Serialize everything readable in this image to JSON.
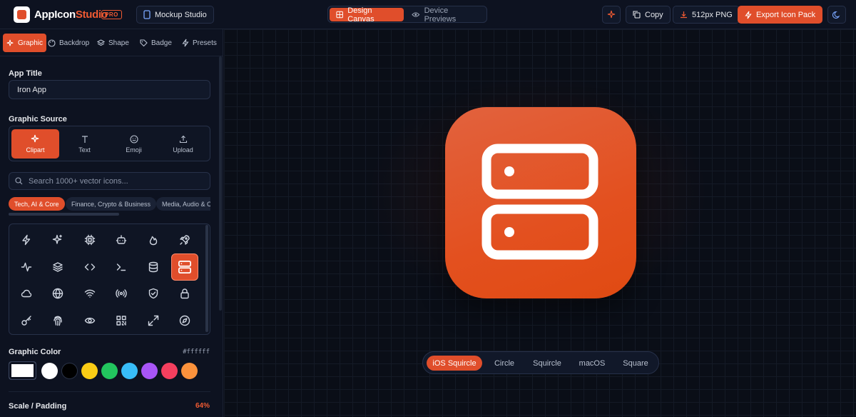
{
  "header": {
    "brand_prefix": "AppIcon",
    "brand_suffix": "Studio",
    "pro_badge": "PRO",
    "mockup_label": "Mockup Studio",
    "view_tabs": [
      {
        "label": "Design Canvas",
        "active": true
      },
      {
        "label": "Device Previews",
        "active": false
      }
    ],
    "copy_label": "Copy",
    "png_label": "512px PNG",
    "export_label": "Export Icon Pack"
  },
  "sidebar": {
    "tabs": [
      {
        "label": "Graphic",
        "active": true,
        "icon": "sparkles-icon"
      },
      {
        "label": "Backdrop",
        "active": false,
        "icon": "palette-icon"
      },
      {
        "label": "Shape",
        "active": false,
        "icon": "layers-icon"
      },
      {
        "label": "Badge",
        "active": false,
        "icon": "tag-icon"
      },
      {
        "label": "Presets",
        "active": false,
        "icon": "zap-icon"
      }
    ],
    "app_title_label": "App Title",
    "app_title_value": "Iron App",
    "graphic_source_label": "Graphic Source",
    "sources": [
      {
        "label": "Clipart",
        "active": true
      },
      {
        "label": "Text",
        "active": false
      },
      {
        "label": "Emoji",
        "active": false
      },
      {
        "label": "Upload",
        "active": false
      }
    ],
    "search_placeholder": "Search 1000+ vector icons...",
    "categories": [
      {
        "label": "Tech, AI & Core",
        "active": true
      },
      {
        "label": "Finance, Crypto & Business",
        "active": false
      },
      {
        "label": "Media, Audio & C…",
        "active": false
      }
    ],
    "icons": [
      "zap-icon",
      "sparkles-icon",
      "cpu-icon",
      "bot-icon",
      "flame-icon",
      "rocket-icon",
      "activity-icon",
      "layers-icon",
      "code-icon",
      "terminal-icon",
      "database-icon",
      "server-icon",
      "cloud-icon",
      "globe-icon",
      "wifi-icon",
      "radio-icon",
      "shield-icon",
      "lock-icon",
      "key-icon",
      "fingerprint-icon",
      "eye-icon",
      "qr-code-icon",
      "maximize-icon",
      "compass-icon"
    ],
    "selected_icon": "server-icon",
    "graphic_color_label": "Graphic Color",
    "graphic_color_value": "#ffffff",
    "swatches": [
      "#ffffff",
      "#000000",
      "#facc15",
      "#22c55e",
      "#38bdf8",
      "#a855f7",
      "#f43f5e",
      "#fb923c"
    ],
    "scale_label": "Scale / Padding",
    "scale_value": "64%"
  },
  "canvas": {
    "icon_gradient": [
      "#e2623e",
      "#e04a12"
    ],
    "shapes": [
      {
        "label": "iOS Squircle",
        "active": true
      },
      {
        "label": "Circle",
        "active": false
      },
      {
        "label": "Squircle",
        "active": false
      },
      {
        "label": "macOS",
        "active": false
      },
      {
        "label": "Square",
        "active": false
      }
    ]
  },
  "colors": {
    "accent": "#e04e2b",
    "background": "#0b0f1a"
  }
}
